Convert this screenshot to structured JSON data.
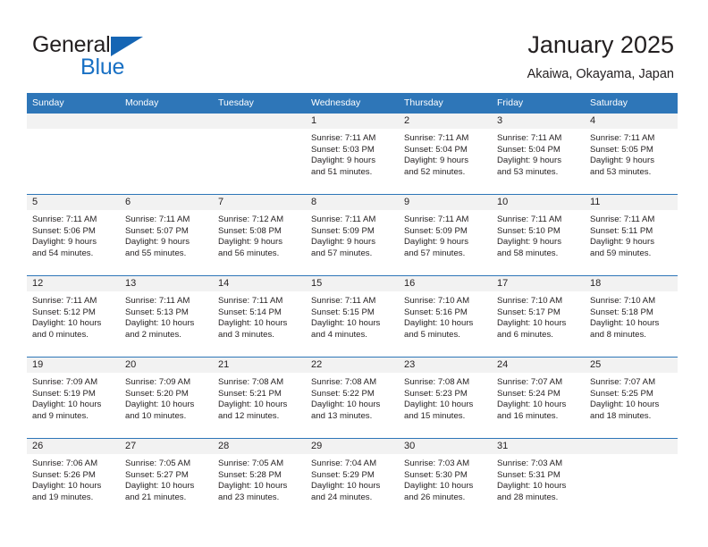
{
  "brand": {
    "word_general": "General",
    "word_blue": "Blue",
    "triangle_icon": "brand-triangle-icon",
    "accent_color": "#1870c4"
  },
  "header": {
    "title": "January 2025",
    "subtitle": "Akaiwa, Okayama, Japan"
  },
  "calendar": {
    "header_bg": "#2e76b8",
    "date_band_bg": "#f2f2f2",
    "weekdays": [
      "Sunday",
      "Monday",
      "Tuesday",
      "Wednesday",
      "Thursday",
      "Friday",
      "Saturday"
    ],
    "weeks": [
      [
        {
          "date": "",
          "lines": []
        },
        {
          "date": "",
          "lines": []
        },
        {
          "date": "",
          "lines": []
        },
        {
          "date": "1",
          "lines": [
            "Sunrise: 7:11 AM",
            "Sunset: 5:03 PM",
            "Daylight: 9 hours",
            "and 51 minutes."
          ]
        },
        {
          "date": "2",
          "lines": [
            "Sunrise: 7:11 AM",
            "Sunset: 5:04 PM",
            "Daylight: 9 hours",
            "and 52 minutes."
          ]
        },
        {
          "date": "3",
          "lines": [
            "Sunrise: 7:11 AM",
            "Sunset: 5:04 PM",
            "Daylight: 9 hours",
            "and 53 minutes."
          ]
        },
        {
          "date": "4",
          "lines": [
            "Sunrise: 7:11 AM",
            "Sunset: 5:05 PM",
            "Daylight: 9 hours",
            "and 53 minutes."
          ]
        }
      ],
      [
        {
          "date": "5",
          "lines": [
            "Sunrise: 7:11 AM",
            "Sunset: 5:06 PM",
            "Daylight: 9 hours",
            "and 54 minutes."
          ]
        },
        {
          "date": "6",
          "lines": [
            "Sunrise: 7:11 AM",
            "Sunset: 5:07 PM",
            "Daylight: 9 hours",
            "and 55 minutes."
          ]
        },
        {
          "date": "7",
          "lines": [
            "Sunrise: 7:12 AM",
            "Sunset: 5:08 PM",
            "Daylight: 9 hours",
            "and 56 minutes."
          ]
        },
        {
          "date": "8",
          "lines": [
            "Sunrise: 7:11 AM",
            "Sunset: 5:09 PM",
            "Daylight: 9 hours",
            "and 57 minutes."
          ]
        },
        {
          "date": "9",
          "lines": [
            "Sunrise: 7:11 AM",
            "Sunset: 5:09 PM",
            "Daylight: 9 hours",
            "and 57 minutes."
          ]
        },
        {
          "date": "10",
          "lines": [
            "Sunrise: 7:11 AM",
            "Sunset: 5:10 PM",
            "Daylight: 9 hours",
            "and 58 minutes."
          ]
        },
        {
          "date": "11",
          "lines": [
            "Sunrise: 7:11 AM",
            "Sunset: 5:11 PM",
            "Daylight: 9 hours",
            "and 59 minutes."
          ]
        }
      ],
      [
        {
          "date": "12",
          "lines": [
            "Sunrise: 7:11 AM",
            "Sunset: 5:12 PM",
            "Daylight: 10 hours",
            "and 0 minutes."
          ]
        },
        {
          "date": "13",
          "lines": [
            "Sunrise: 7:11 AM",
            "Sunset: 5:13 PM",
            "Daylight: 10 hours",
            "and 2 minutes."
          ]
        },
        {
          "date": "14",
          "lines": [
            "Sunrise: 7:11 AM",
            "Sunset: 5:14 PM",
            "Daylight: 10 hours",
            "and 3 minutes."
          ]
        },
        {
          "date": "15",
          "lines": [
            "Sunrise: 7:11 AM",
            "Sunset: 5:15 PM",
            "Daylight: 10 hours",
            "and 4 minutes."
          ]
        },
        {
          "date": "16",
          "lines": [
            "Sunrise: 7:10 AM",
            "Sunset: 5:16 PM",
            "Daylight: 10 hours",
            "and 5 minutes."
          ]
        },
        {
          "date": "17",
          "lines": [
            "Sunrise: 7:10 AM",
            "Sunset: 5:17 PM",
            "Daylight: 10 hours",
            "and 6 minutes."
          ]
        },
        {
          "date": "18",
          "lines": [
            "Sunrise: 7:10 AM",
            "Sunset: 5:18 PM",
            "Daylight: 10 hours",
            "and 8 minutes."
          ]
        }
      ],
      [
        {
          "date": "19",
          "lines": [
            "Sunrise: 7:09 AM",
            "Sunset: 5:19 PM",
            "Daylight: 10 hours",
            "and 9 minutes."
          ]
        },
        {
          "date": "20",
          "lines": [
            "Sunrise: 7:09 AM",
            "Sunset: 5:20 PM",
            "Daylight: 10 hours",
            "and 10 minutes."
          ]
        },
        {
          "date": "21",
          "lines": [
            "Sunrise: 7:08 AM",
            "Sunset: 5:21 PM",
            "Daylight: 10 hours",
            "and 12 minutes."
          ]
        },
        {
          "date": "22",
          "lines": [
            "Sunrise: 7:08 AM",
            "Sunset: 5:22 PM",
            "Daylight: 10 hours",
            "and 13 minutes."
          ]
        },
        {
          "date": "23",
          "lines": [
            "Sunrise: 7:08 AM",
            "Sunset: 5:23 PM",
            "Daylight: 10 hours",
            "and 15 minutes."
          ]
        },
        {
          "date": "24",
          "lines": [
            "Sunrise: 7:07 AM",
            "Sunset: 5:24 PM",
            "Daylight: 10 hours",
            "and 16 minutes."
          ]
        },
        {
          "date": "25",
          "lines": [
            "Sunrise: 7:07 AM",
            "Sunset: 5:25 PM",
            "Daylight: 10 hours",
            "and 18 minutes."
          ]
        }
      ],
      [
        {
          "date": "26",
          "lines": [
            "Sunrise: 7:06 AM",
            "Sunset: 5:26 PM",
            "Daylight: 10 hours",
            "and 19 minutes."
          ]
        },
        {
          "date": "27",
          "lines": [
            "Sunrise: 7:05 AM",
            "Sunset: 5:27 PM",
            "Daylight: 10 hours",
            "and 21 minutes."
          ]
        },
        {
          "date": "28",
          "lines": [
            "Sunrise: 7:05 AM",
            "Sunset: 5:28 PM",
            "Daylight: 10 hours",
            "and 23 minutes."
          ]
        },
        {
          "date": "29",
          "lines": [
            "Sunrise: 7:04 AM",
            "Sunset: 5:29 PM",
            "Daylight: 10 hours",
            "and 24 minutes."
          ]
        },
        {
          "date": "30",
          "lines": [
            "Sunrise: 7:03 AM",
            "Sunset: 5:30 PM",
            "Daylight: 10 hours",
            "and 26 minutes."
          ]
        },
        {
          "date": "31",
          "lines": [
            "Sunrise: 7:03 AM",
            "Sunset: 5:31 PM",
            "Daylight: 10 hours",
            "and 28 minutes."
          ]
        },
        {
          "date": "",
          "lines": []
        }
      ]
    ]
  }
}
